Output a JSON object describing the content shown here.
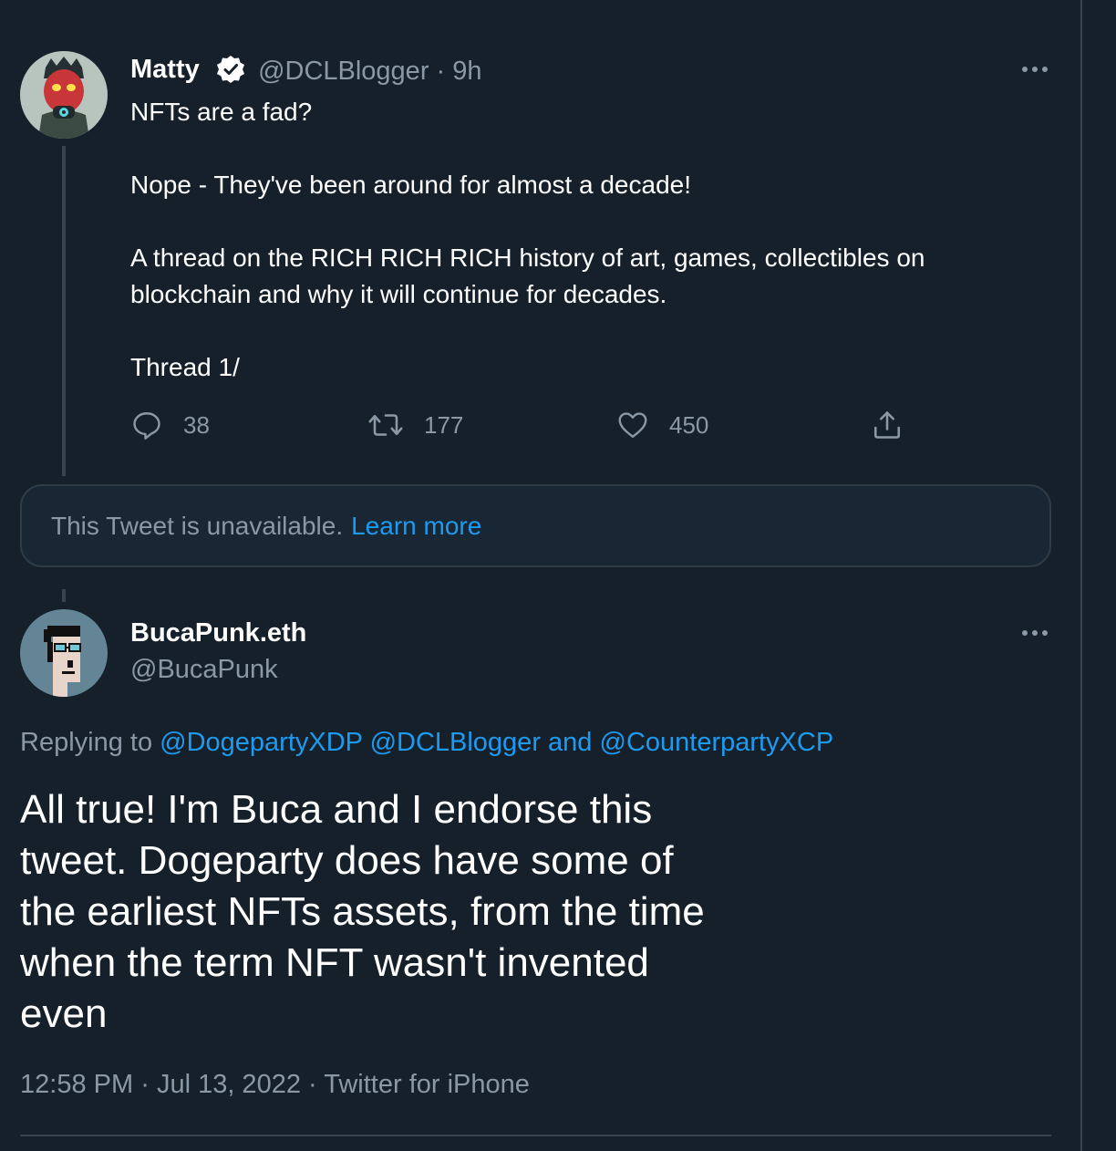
{
  "tweet1": {
    "name": "Matty",
    "handle": "@DCLBlogger",
    "separator": "·",
    "time": "9h",
    "lines": [
      "NFTs are a fad?",
      "Nope - They've been around for almost a decade!",
      "A thread on the RICH RICH RICH history of art, games, collectibles on blockchain and why it will continue for decades.",
      "Thread 1/"
    ],
    "replies": "38",
    "retweets": "177",
    "likes": "450"
  },
  "unavailable": {
    "text": "This Tweet is unavailable.",
    "link": "Learn more"
  },
  "tweet2": {
    "name": "BucaPunk.eth",
    "handle": "@BucaPunk",
    "replying_prefix": "Replying to",
    "reply_mention1": "@DogepartyXDP",
    "reply_mention2": "@DCLBlogger",
    "reply_and": "and",
    "reply_mention3": "@CounterpartyXCP",
    "text": "All true! I'm Buca and I endorse this tweet. Dogeparty does have some of the earliest NFTs assets, from the time when the term NFT wasn't invented even",
    "time": "12:58 PM",
    "date": "Jul 13, 2022",
    "source": "Twitter for iPhone",
    "sep": "·"
  },
  "colors": {
    "background": "#15202b",
    "link": "#1d9bf0",
    "muted": "#8b98a5",
    "border": "#38444d"
  }
}
